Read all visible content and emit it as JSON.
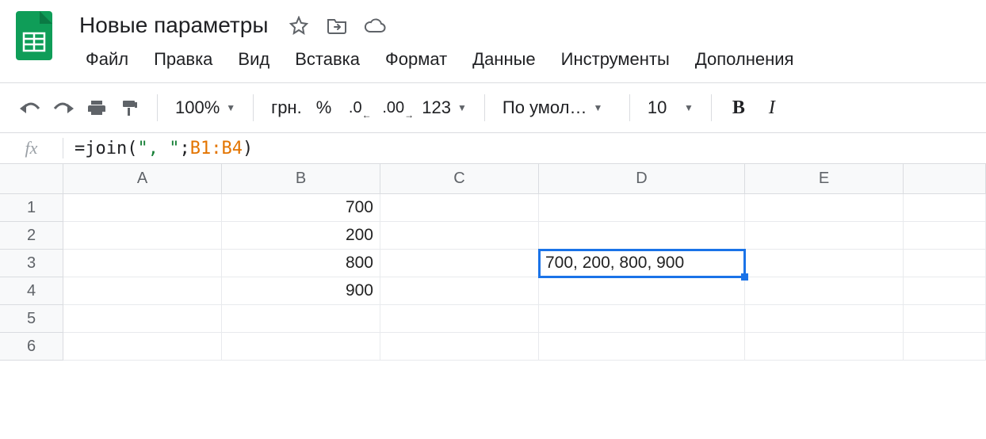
{
  "doc": {
    "title": "Новые параметры"
  },
  "menus": [
    "Файл",
    "Правка",
    "Вид",
    "Вставка",
    "Формат",
    "Данные",
    "Инструменты",
    "Дополнения"
  ],
  "toolbar": {
    "zoom": "100%",
    "currency": "грн.",
    "percent": "%",
    "dec_dec": ".0",
    "inc_dec": ".00",
    "format_num": "123",
    "font": "По умол…",
    "font_size": "10"
  },
  "formula": {
    "fx": "fx",
    "prefix": "=join(",
    "arg1": "\", \"",
    "sep": ";",
    "arg2": "B1:B4",
    "suffix": ")"
  },
  "columns": [
    "A",
    "B",
    "C",
    "D",
    "E"
  ],
  "rows": [
    "1",
    "2",
    "3",
    "4",
    "5",
    "6"
  ],
  "cells": {
    "B1": "700",
    "B2": "200",
    "B3": "800",
    "B4": "900",
    "D3": "700, 200, 800, 900"
  },
  "selected_cell": "D3"
}
